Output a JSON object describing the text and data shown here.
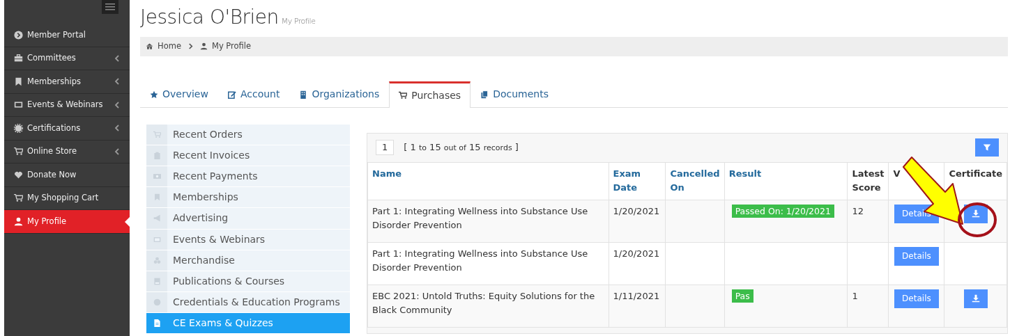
{
  "sidebar": {
    "items": [
      {
        "label": "Member Portal",
        "expandable": false,
        "selected": false
      },
      {
        "label": "Committees",
        "expandable": true,
        "selected": false
      },
      {
        "label": "Memberships",
        "expandable": true,
        "selected": false
      },
      {
        "label": "Events & Webinars",
        "expandable": true,
        "selected": false
      },
      {
        "label": "Certifications",
        "expandable": true,
        "selected": false
      },
      {
        "label": "Online Store",
        "expandable": true,
        "selected": false
      },
      {
        "label": "Donate Now",
        "expandable": false,
        "selected": false
      },
      {
        "label": "My Shopping Cart",
        "expandable": false,
        "selected": false
      },
      {
        "label": "My Profile",
        "expandable": false,
        "selected": true
      }
    ]
  },
  "header": {
    "title": "Jessica O'Brien",
    "subtitle": "My Profile"
  },
  "breadcrumb": [
    "Home",
    "My Profile"
  ],
  "tabs": [
    {
      "label": "Overview",
      "selected": false
    },
    {
      "label": "Account",
      "selected": false
    },
    {
      "label": "Organizations",
      "selected": false
    },
    {
      "label": "Purchases",
      "selected": true
    },
    {
      "label": "Documents",
      "selected": false
    }
  ],
  "purchase_menu": [
    {
      "label": "Recent Orders",
      "selected": false
    },
    {
      "label": "Recent Invoices",
      "selected": false
    },
    {
      "label": "Recent Payments",
      "selected": false
    },
    {
      "label": "Memberships",
      "selected": false
    },
    {
      "label": "Advertising",
      "selected": false
    },
    {
      "label": "Events & Webinars",
      "selected": false
    },
    {
      "label": "Merchandise",
      "selected": false
    },
    {
      "label": "Publications & Courses",
      "selected": false
    },
    {
      "label": "Credentials & Education Programs",
      "selected": false
    },
    {
      "label": "CE Exams & Quizzes",
      "selected": true
    }
  ],
  "pager": {
    "page": "1",
    "range": {
      "open": "[",
      "from": "1",
      "to_word": "to",
      "to": "15",
      "out_of": "out of",
      "total": "15",
      "records": "records",
      "close": "]"
    }
  },
  "table": {
    "columns": [
      {
        "label": "Name",
        "sortable": true
      },
      {
        "label": "Exam Date",
        "sortable": true
      },
      {
        "label": "Cancelled On",
        "sortable": true
      },
      {
        "label": "Result",
        "sortable": true
      },
      {
        "label": "Latest Score",
        "sortable": false
      },
      {
        "label": "V",
        "sortable": false
      },
      {
        "label": "Certificate",
        "sortable": false
      }
    ],
    "rows": [
      {
        "name": "Part 1: Integrating Wellness into Substance Use Disorder Prevention",
        "exam_date": "1/20/2021",
        "result": "Passed On: 1/20/2021",
        "score": "12",
        "details": "Details",
        "certificate": true
      },
      {
        "name": "Part 1: Integrating Wellness into Substance Use Disorder Prevention",
        "exam_date": "1/20/2021",
        "details": "Details",
        "certificate": false
      },
      {
        "name": "EBC 2021: Untold Truths: Equity Solutions for the Black Community",
        "exam_date": "1/11/2021",
        "result": "Pas",
        "score": "1",
        "details": "Details",
        "certificate": true
      }
    ]
  }
}
